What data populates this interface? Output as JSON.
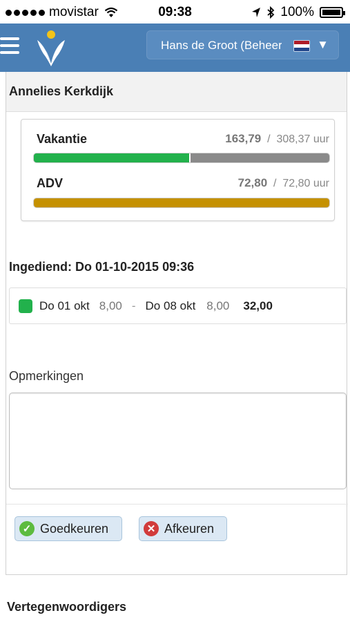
{
  "status_bar": {
    "carrier": "movistar",
    "time": "09:38",
    "battery": "100%"
  },
  "header": {
    "user_name": "Hans de Groot (Beheerder)",
    "flag_colors": [
      "#ae1c28",
      "#ffffff",
      "#21468b"
    ]
  },
  "employee": {
    "name": "Annelies Kerkdijk"
  },
  "balances": [
    {
      "label": "Vakantie",
      "used": "163,79",
      "separator": "/",
      "total": "308,37 uur",
      "fraction": 0.531,
      "color": "#22b14c"
    },
    {
      "label": "ADV",
      "used": "72,80",
      "separator": "/",
      "total": "72,80 uur",
      "fraction": 1.0,
      "color": "#c59100"
    }
  ],
  "request": {
    "submitted": "Ingediend: Do 01-10-2015 09:36",
    "status_color": "#22b14c",
    "from_date": "Do 01 okt",
    "from_hours": "8,00",
    "dash": "-",
    "to_date": "Do 08 okt",
    "to_hours": "8,00",
    "total_hours": "32,00"
  },
  "remarks": {
    "label": "Opmerkingen",
    "value": ""
  },
  "actions": {
    "approve_label": "Goedkeuren",
    "reject_label": "Afkeuren"
  },
  "representatives": {
    "title": "Vertegenwoordigers"
  }
}
